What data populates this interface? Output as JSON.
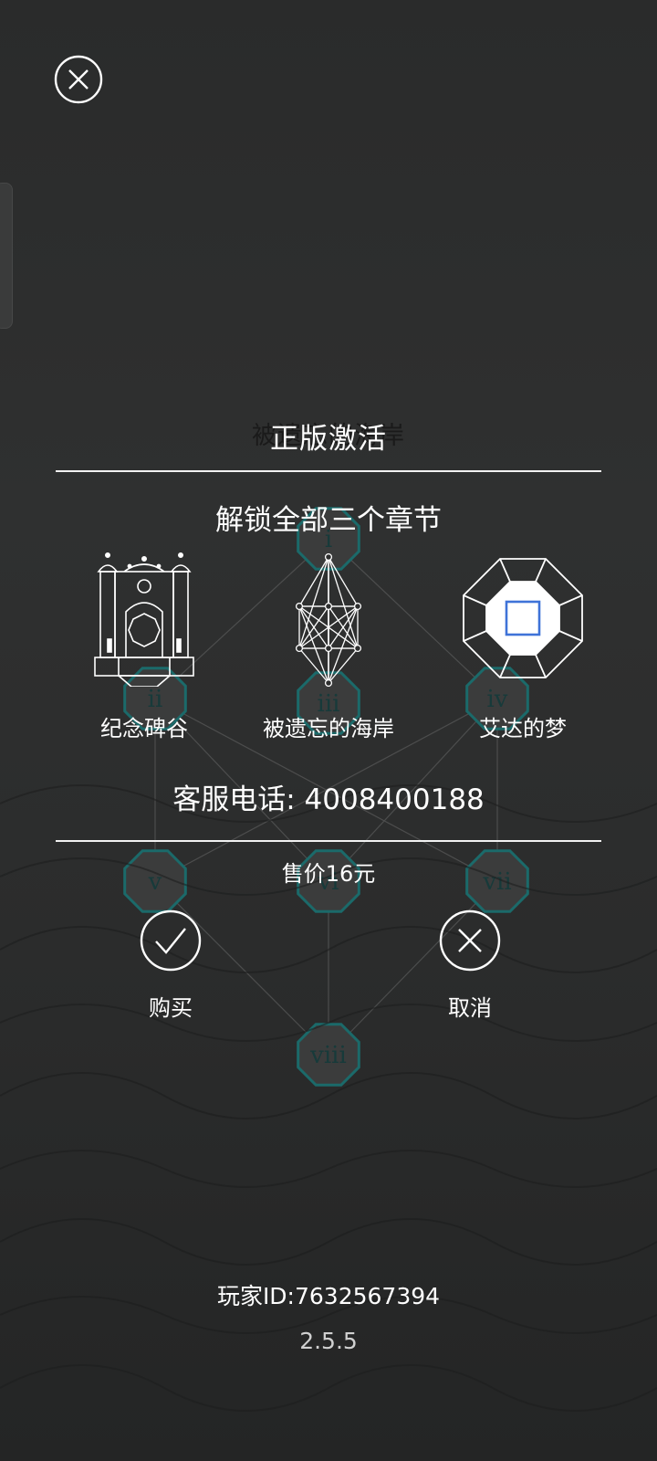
{
  "background": {
    "nodes": [
      {
        "label": "i"
      },
      {
        "label": "ii"
      },
      {
        "label": "iii"
      },
      {
        "label": "iv"
      },
      {
        "label": "v"
      },
      {
        "label": "vi"
      },
      {
        "label": "vii"
      },
      {
        "label": "viii"
      }
    ],
    "ghost_title": "被遗忘的海岸"
  },
  "dialog": {
    "title": "正版激活",
    "subtitle": "解锁全部三个章节",
    "chapters": [
      {
        "name": "纪念碑谷",
        "icon": "palace-icon"
      },
      {
        "name": "被遗忘的海岸",
        "icon": "geometric-network-icon"
      },
      {
        "name": "艾达的梦",
        "icon": "octagon-square-icon"
      }
    ],
    "phone": "客服电话: 4008400188",
    "price": "售价16元",
    "buy_label": "购买",
    "cancel_label": "取消"
  },
  "footer": {
    "player_id": "玩家ID:7632567394",
    "version": "2.5.5"
  },
  "colors": {
    "background": "#2b2c2c",
    "node_fill": "#3b3c3c",
    "node_border": "#1b6a6a",
    "text": "#ffffff",
    "accent_square": "#3f73d8"
  }
}
